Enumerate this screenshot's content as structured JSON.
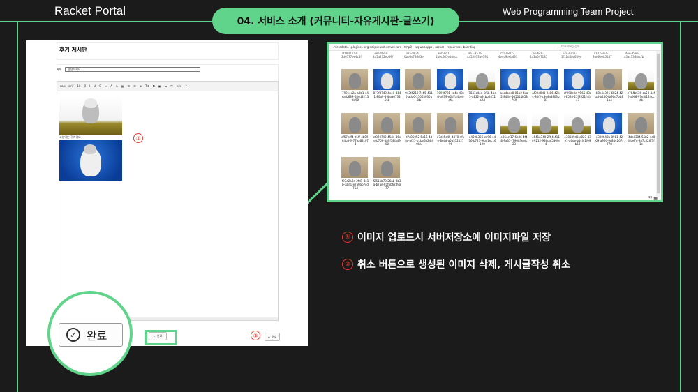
{
  "header": {
    "brand": "Racket Portal",
    "section_title": "04. 서비스 소개 (커뮤니티-자유게시판-글쓰기)",
    "project": "Web Programming Team Project"
  },
  "board": {
    "title": "후기 게시판",
    "subject_label": "제목",
    "subject_value": "안녕하세요",
    "toolbar": [
      "sans-serif",
      "10",
      "B",
      "I",
      "U",
      "S",
      "≡",
      "A",
      "A",
      "▦",
      "☰",
      "☰",
      "≣",
      "T↕",
      "⧉",
      "▣",
      "▬",
      "⤧",
      "</>",
      "?"
    ],
    "caption": "고양이는 귀여워요",
    "done_label": "완료",
    "cancel_label": "취소",
    "marker1": "①",
    "marker2": "②"
  },
  "zoom": {
    "label": "완료"
  },
  "explorer": {
    "path": ".metadata  ›  .plugins  ›  org.eclipse.wst.server.core  ›  tmp0  ›  wtpwebapps  ›  racket  ›  resources  ›  boarding",
    "search_placeholder": "boarding 검색",
    "top_row": [
      "4f1807a13-3de577ee4c5f",
      "eef-dbe3-4a5a232eb89f",
      "3a5-882f-0be5e734d3e",
      "8e0-8d7-4b0c6d7ed0ccc",
      "ae7-8a7a-4a55973a9191",
      "b51-0947-4e4c9eeb493",
      "e6-6c8-4a3a647185",
      "544-8a11-1f12d48c659e",
      "4122-9b4-9a66ee85447",
      "4ee-d5ea-a3ac7348ccfb"
    ],
    "files": [
      {
        "name": "799e4c2a-a3b1-44ea-b689-68dd3213de98",
        "tone": "beige"
      },
      {
        "name": "877fd743-4ee0-4141-80a9-39baa073856b",
        "tone": "blue"
      },
      {
        "name": "943f4210-7c65-4110-ada6-25063030b6fb",
        "tone": "beige"
      },
      {
        "name": "1090f781-ca4e-48ed-a939-e6d7a4be0efa",
        "tone": "blue"
      },
      {
        "name": "7847c4ed-5f5b-4be5-a832-a2cbb0412b2d",
        "tone": "grass"
      },
      {
        "name": "a4cdbee8-01b2-4ca2-844d-5d5044b58769",
        "tone": "blue"
      },
      {
        "name": "af02e0d3-2c86-42ac-80f2-c8e4a8803b81",
        "tone": "blue"
      },
      {
        "name": "af990e0a-9165-48af-8528-27f9521fdfac7",
        "tone": "blue"
      },
      {
        "name": "b8e4e325-6824-42ad-b450-fb90d7bb81b4",
        "tone": "beige"
      },
      {
        "name": "c764b636-ca58-44ff-a068-97e5f124ccdb",
        "tone": "grass"
      },
      {
        "name": "cf57cdf4-d1ff-4b09-84b3-f977aa84c074",
        "tone": "beige"
      },
      {
        "name": "cf320742-45d4-46ee-b760-d89f38fa4900",
        "tone": "beige"
      },
      {
        "name": "d7c85052-5e16-4d8c-af27-b1be6b24d00a",
        "tone": "beige"
      },
      {
        "name": "d7dc5c45-4370-4fae-8c4d-a5a35212796",
        "tone": "beige"
      },
      {
        "name": "d459b326-cd96-4d36-b727-9ibd1ec16120",
        "tone": "blue"
      },
      {
        "name": "e36ecf17-6e86-4f48-9a35-f79083eefc23",
        "tone": "grass"
      },
      {
        "name": "e541a740-2f64-411f-9212-936caf586fa4",
        "tone": "grass"
      },
      {
        "name": "e780d9d3-e027-43e1-a6de-b1cfc1f09b50",
        "tone": "grass"
      },
      {
        "name": "e300640b-8981-4269-a966-9c8d4267f778",
        "tone": "blue"
      },
      {
        "name": "f4dc4384-5582-4e04-be7d-9a7c026f3f1e",
        "tone": "beige"
      },
      {
        "name": "f93d2a8d-2fd1-4e1b-abd1-e7a0a67cd75d",
        "tone": "beige"
      },
      {
        "name": "f251bb79-26ab-4b3a-b7ae-81fbb62d9a77",
        "tone": "beige"
      }
    ]
  },
  "notes": [
    {
      "marker": "①",
      "text": "이미지 업로드시 서버저장소에 이미지파일 저장"
    },
    {
      "marker": "②",
      "text": "취소 버튼으로 생성된 이미지 삭제, 게시글작성 취소"
    }
  ],
  "colors": {
    "accent": "#5fd48a",
    "marker": "#e63b33",
    "background": "#1b1b1b"
  }
}
